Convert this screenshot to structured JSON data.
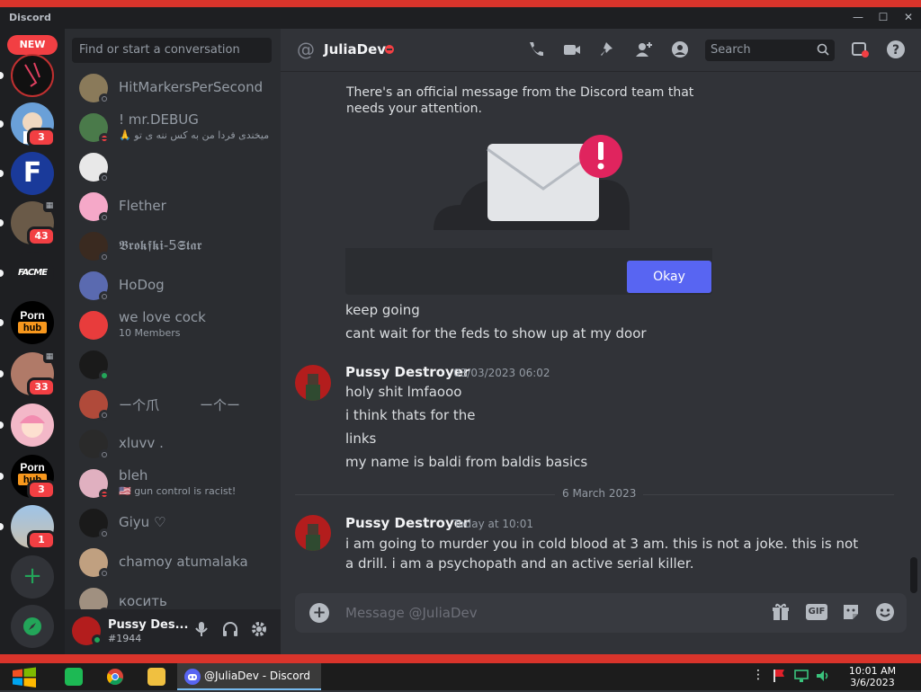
{
  "window": {
    "app_title": "Discord",
    "controls": [
      "—",
      "☐",
      "✕"
    ]
  },
  "server_rail": {
    "new_badge": "NEW",
    "servers": [
      {
        "name": "server-1",
        "badge": ""
      },
      {
        "name": "server-2",
        "badge": "3"
      },
      {
        "name": "server-3",
        "text": "F",
        "badge": ""
      },
      {
        "name": "server-4",
        "badge": "43"
      },
      {
        "name": "server-5",
        "text": "FACME",
        "badge": ""
      },
      {
        "name": "server-6",
        "text": "Porn hub",
        "badge": ""
      },
      {
        "name": "server-7",
        "badge": "33"
      },
      {
        "name": "server-8",
        "badge": ""
      },
      {
        "name": "server-9",
        "text": "Porn hub",
        "badge": "3"
      },
      {
        "name": "server-10",
        "badge": "1"
      }
    ],
    "add_label": "+",
    "discover_label": "⊙"
  },
  "dm_panel": {
    "search_placeholder": "Find or start a conversation",
    "items": [
      {
        "name": "HitMarkersPerSecond",
        "sub": "",
        "status": "off",
        "color": "#8a7a5a"
      },
      {
        "name": "! mr.DEBUG",
        "sub": "🙏 من میخندی فردا من به کس ننه ی تو...",
        "status": "dnd",
        "color": "#4a7a4a"
      },
      {
        "name": "",
        "sub": "",
        "status": "off",
        "color": "#e8e8e8"
      },
      {
        "name": "Flether",
        "sub": "",
        "status": "off",
        "color": "#f5a8c8"
      },
      {
        "name": "𝕭𝖗𝖔𝖐𝖋𝖐𝖎-5𝕾𝖙𝖆𝖗",
        "sub": "",
        "status": "off",
        "color": "#3a2a20"
      },
      {
        "name": "HoDog",
        "sub": "",
        "status": "off",
        "color": "#5a6ab0"
      },
      {
        "name": "we love cock",
        "sub": "10 Members",
        "status": "",
        "color": "#e83c3c"
      },
      {
        "name": "",
        "sub": "",
        "status": "on",
        "color": "#1a1a1a"
      },
      {
        "name": "ー个爪　　　ー个ー",
        "sub": "",
        "status": "off",
        "color": "#b04a3a"
      },
      {
        "name": "xluvv .",
        "sub": "",
        "status": "off",
        "color": "#2a2a2a"
      },
      {
        "name": "bleh",
        "sub": "🇺🇸 gun control is racist!",
        "status": "dnd",
        "color": "#e0b0c0"
      },
      {
        "name": "Giyu ♡",
        "sub": "",
        "status": "off",
        "color": "#1a1a1a"
      },
      {
        "name": "chamoy atumalaka",
        "sub": "",
        "status": "off",
        "color": "#c0a080"
      },
      {
        "name": "косить",
        "sub": "",
        "status": "off",
        "color": "#a09080"
      }
    ]
  },
  "user_bar": {
    "username": "Pussy Des...",
    "tag": "#1944"
  },
  "header": {
    "at_symbol": "@",
    "name": "JuliaDev",
    "search_placeholder": "Search"
  },
  "messages": {
    "system_text": "There's an official message from the Discord team that needs your attention.",
    "ok_label": "Okay",
    "early_lines": [
      "keep going",
      "cant wait for the feds to show up at my door"
    ],
    "group1": {
      "author": "Pussy Destroyer",
      "timestamp": "03/03/2023 06:02",
      "lines": [
        "holy shit lmfaooo",
        "i think thats for the",
        "links",
        "my name is baldi from baldis basics"
      ]
    },
    "date_divider": "6 March 2023",
    "group2": {
      "author": "Pussy Destroyer",
      "timestamp": "Today at 10:01",
      "text": "i am going to murder you in cold blood at 3 am. this is not a joke. this is not a drill. i am a psychopath and an active serial killer."
    }
  },
  "composer": {
    "placeholder": "Message @JuliaDev",
    "gif_label": "GIF"
  },
  "taskbar": {
    "active_window": "@JuliaDev - Discord",
    "time": "10:01 AM",
    "date": "3/6/2023"
  }
}
